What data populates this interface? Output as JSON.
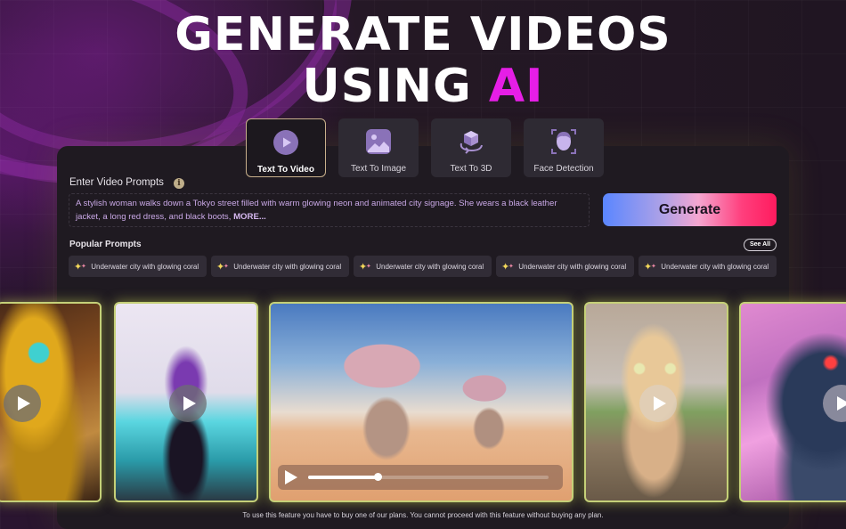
{
  "hero": {
    "line1": "GENERATE VIDEOS",
    "line2_prefix": "USING",
    "line2_highlight": "AI",
    "accent_color": "#e61ee6"
  },
  "tabs": [
    {
      "label": "Text To Video",
      "icon": "play-circle-icon",
      "active": true
    },
    {
      "label": "Text To Image",
      "icon": "image-icon",
      "active": false
    },
    {
      "label": "Text To 3D",
      "icon": "cube-rotate-icon",
      "active": false
    },
    {
      "label": "Face Detection",
      "icon": "face-scan-icon",
      "active": false
    }
  ],
  "prompt": {
    "label": "Enter Video Prompts",
    "info_icon": "i",
    "text": "A stylish woman walks down a  Tokyo street filled with warm glowing neon and animated city signage.  She wears a black leather jacket, a long red dress, and black boots, ",
    "more": "MORE..."
  },
  "generate_label": "Generate",
  "popular": {
    "label": "Popular Prompts",
    "see_all": "See All",
    "chips": [
      "Underwater city with glowing coral",
      "Underwater city with glowing coral",
      "Underwater city with glowing coral",
      "Underwater city with glowing coral",
      "Underwater city with glowing coral"
    ]
  },
  "gallery": {
    "videos": [
      {
        "subject": "robotic bee"
      },
      {
        "subject": "glowing dancer"
      },
      {
        "subject": "desert aliens",
        "featured": true,
        "progress": 0.29
      },
      {
        "subject": "kitten"
      },
      {
        "subject": "cyber dragon"
      }
    ]
  },
  "disclaimer": "To use this feature you have to buy one of our plans. You cannot proceed with this feature without buying any plan."
}
